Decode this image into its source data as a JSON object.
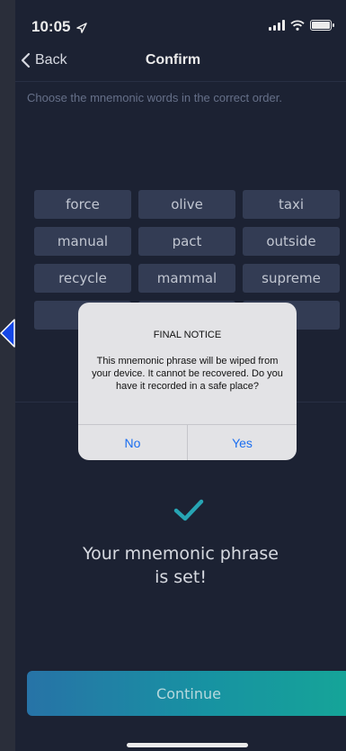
{
  "status_bar": {
    "time": "10:05"
  },
  "nav": {
    "back_label": "Back",
    "title": "Confirm"
  },
  "instruction": "Choose the mnemonic words in the correct order.",
  "words": [
    "force",
    "olive",
    "taxi",
    "manual",
    "pact",
    "outside",
    "recycle",
    "mammal",
    "supreme",
    "",
    "",
    ""
  ],
  "alert": {
    "title": "FINAL NOTICE",
    "message": "This mnemonic phrase will be wiped from your device. It cannot be recovered. Do you have it recorded in a safe place?",
    "no_label": "No",
    "yes_label": "Yes"
  },
  "success": {
    "line1": "Your mnemonic phrase",
    "line2": "is set!"
  },
  "continue_label": "Continue",
  "colors": {
    "background": "#1f2538",
    "chip": "#38425c",
    "accent": "#2bb3c4",
    "alert_button": "#1b6ef0"
  },
  "icons": {
    "back": "chevron-left-icon",
    "location": "location-arrow-icon",
    "success": "checkmark-icon"
  }
}
